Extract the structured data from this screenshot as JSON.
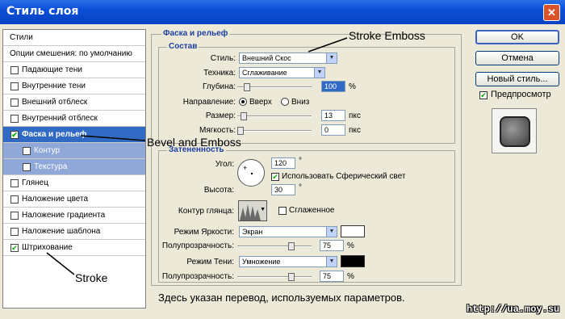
{
  "window": {
    "title": "Стиль слоя",
    "close_glyph": "✕"
  },
  "left_panel": {
    "items": [
      {
        "label": "Стили",
        "checkbox": false
      },
      {
        "label": "Опции смешения: по умолчанию",
        "checkbox": false
      },
      {
        "label": "Падающие тени",
        "checkbox": true,
        "checked": false
      },
      {
        "label": "Внутренние тени",
        "checkbox": true,
        "checked": false
      },
      {
        "label": "Внешний отблеск",
        "checkbox": true,
        "checked": false
      },
      {
        "label": "Внутренний отблеск",
        "checkbox": true,
        "checked": false
      },
      {
        "label": "Фаска и рельеф",
        "checkbox": true,
        "checked": true,
        "selected": true
      },
      {
        "label": "Контур",
        "checkbox": true,
        "checked": false,
        "sub": true
      },
      {
        "label": "Текстура",
        "checkbox": true,
        "checked": false,
        "sub": true
      },
      {
        "label": "Глянец",
        "checkbox": true,
        "checked": false
      },
      {
        "label": "Наложение цвета",
        "checkbox": true,
        "checked": false
      },
      {
        "label": "Наложение градиента",
        "checkbox": true,
        "checked": false
      },
      {
        "label": "Наложение шаблона",
        "checkbox": true,
        "checked": false
      },
      {
        "label": "Штрихование",
        "checkbox": true,
        "checked": true
      }
    ]
  },
  "bevel": {
    "group_title": "Фаска и рельеф",
    "structure_title": "Состав",
    "style_label": "Стиль:",
    "style_value": "Внешний Скос",
    "technique_label": "Техника:",
    "technique_value": "Сглаживание",
    "depth_label": "Глубина:",
    "depth_value": "100",
    "depth_unit": "%",
    "depth_level": 0.1,
    "direction_label": "Направление:",
    "direction_up": "Вверх",
    "direction_down": "Вниз",
    "direction_selected": "up",
    "size_label": "Размер:",
    "size_value": "13",
    "size_unit": "пкс",
    "size_level": 0.05,
    "soften_label": "Мягкость:",
    "soften_value": "0",
    "soften_unit": "пкс",
    "soften_level": 0.0
  },
  "shading": {
    "title": "Затененность",
    "angle_label": "Угол:",
    "angle_value": "120",
    "angle_unit": "°",
    "global_light_label": "Использовать Сферический свет",
    "global_light_checked": true,
    "altitude_label": "Высота:",
    "altitude_value": "30",
    "altitude_unit": "°",
    "gloss_label": "Контур глянца:",
    "antialias_label": "Сглаженное",
    "antialias_checked": false,
    "highlight_mode_label": "Режим Яркости:",
    "highlight_mode_value": "Экран",
    "highlight_color": "#ffffff",
    "highlight_opacity_label": "Полупрозрачность:",
    "highlight_opacity_value": "75",
    "highlight_opacity_unit": "%",
    "highlight_opacity_level": 0.75,
    "shadow_mode_label": "Режим Тени:",
    "shadow_mode_value": "Умножение",
    "shadow_color": "#000000",
    "shadow_opacity_label": "Полупрозрачность:",
    "shadow_opacity_value": "75",
    "shadow_opacity_unit": "%",
    "shadow_opacity_level": 0.75
  },
  "buttons": {
    "ok": "OK",
    "cancel": "Отмена",
    "new_style": "Новый стиль...",
    "preview_label": "Предпросмотр",
    "preview_checked": true
  },
  "annotations": {
    "stroke_emboss": "Stroke Emboss",
    "bevel_emboss": "Bevel and Emboss",
    "stroke": "Stroke",
    "note": "Здесь указан перевод, используемых параметров.",
    "url": "http://ua.moy.su"
  },
  "accent": "#316ac5"
}
